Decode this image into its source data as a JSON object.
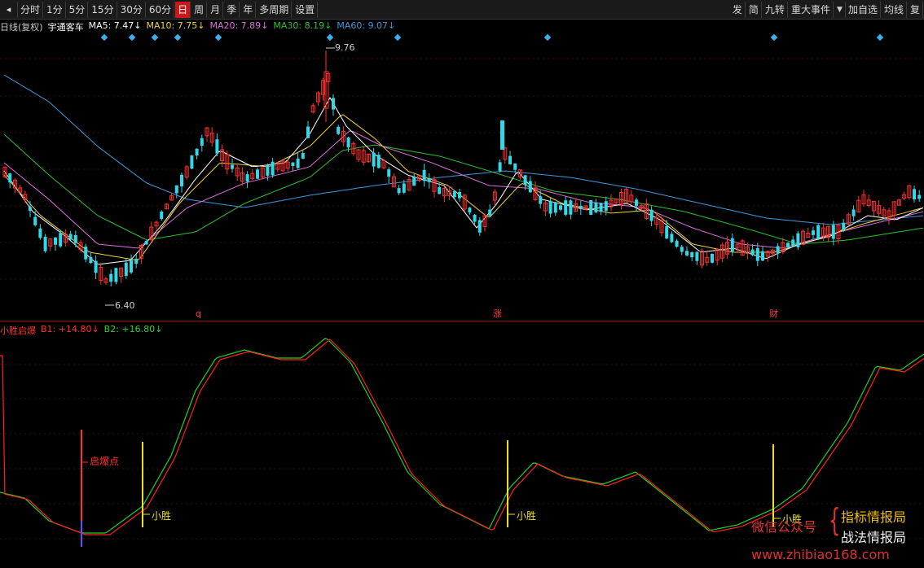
{
  "toolbar": {
    "left_icon": "◂",
    "periods": [
      {
        "label": "分时",
        "active": false
      },
      {
        "label": "1分",
        "active": false
      },
      {
        "label": "5分",
        "active": false
      },
      {
        "label": "15分",
        "active": false
      },
      {
        "label": "30分",
        "active": false
      },
      {
        "label": "60分",
        "active": false
      },
      {
        "label": "日",
        "active": true
      },
      {
        "label": "周",
        "active": false
      },
      {
        "label": "月",
        "active": false
      },
      {
        "label": "季",
        "active": false
      },
      {
        "label": "年",
        "active": false
      },
      {
        "label": "多周期",
        "active": false
      },
      {
        "label": "设置",
        "active": false
      }
    ],
    "right_buttons": [
      "发",
      "简",
      "九转",
      "重大事件"
    ],
    "right_buttons2": [
      "加自选",
      "均线",
      "复"
    ]
  },
  "info": {
    "mode": "日线(复权)",
    "stock": "宇通客车",
    "ma5": "MA5: 7.47↓",
    "ma10": "MA10: 7.75↓",
    "ma20": "MA20: 7.89↓",
    "ma30": "MA30: 8.19↓",
    "ma60": "MA60: 9.07↓"
  },
  "price": {
    "high_label": "9.76",
    "low_label": "6.40",
    "markers": [
      "q",
      "涨",
      "财"
    ]
  },
  "indicator": {
    "name": "小胜启爆",
    "b1": "B1: +14.80↓",
    "b2": "B2: +16.80↓",
    "labels": {
      "qibao": "启爆点",
      "xiaosheng": "小胜"
    }
  },
  "watermark": {
    "wechat": "微信公众号",
    "brace": "{",
    "line1": "指标情报局",
    "line2": "战法情报局",
    "url": "www.zhibiao168.com"
  },
  "colors": {
    "up": "#ff3030",
    "down": "#30d8e8",
    "ma5": "#ffffff",
    "ma10": "#f0d040",
    "ma20": "#e070e0",
    "ma30": "#30c030",
    "ma60": "#4098d8",
    "b1": "#ff2020",
    "b2": "#20d020",
    "signal": "#f0e020"
  }
}
